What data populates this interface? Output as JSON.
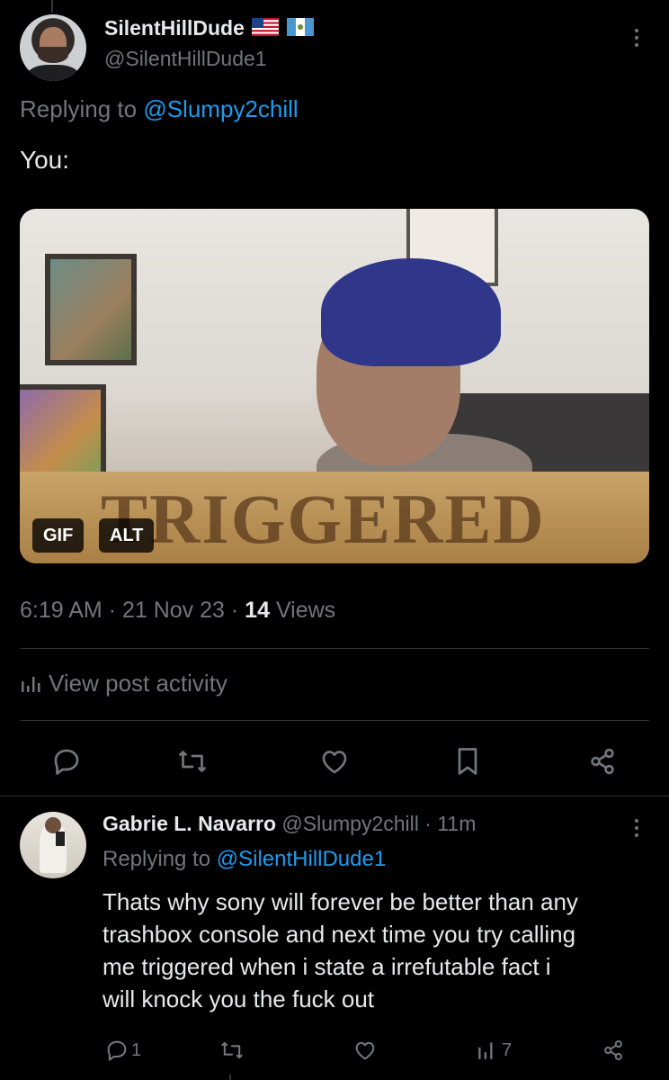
{
  "tweet": {
    "display_name": "SilentHillDude",
    "flags": [
      "us-flag",
      "guatemala-flag"
    ],
    "handle": "@SilentHillDude1",
    "replying_prefix": "Replying to",
    "replying_to": "@Slumpy2chill",
    "text": "You:",
    "media": {
      "overlay_text": "TRIGGERED",
      "badges": [
        "GIF",
        "ALT"
      ]
    },
    "time": "6:19 AM",
    "date": "21 Nov 23",
    "views_count": "14",
    "views_label": "Views",
    "separator": "·",
    "activity_label": "View post activity",
    "actions": [
      "reply-icon",
      "retweet-icon",
      "like-icon",
      "bookmark-icon",
      "share-icon"
    ]
  },
  "reply": {
    "display_name": "Gabrie L. Navarro",
    "handle": "@Slumpy2chill",
    "time_ago": "11m",
    "separator": "·",
    "replying_prefix": "Replying to",
    "replying_to": "@SilentHillDude1",
    "text_lines": [
      "Thats why sony will forever be better than any",
      "trashbox console and next time you try calling",
      "me triggered when i state a irrefutable fact i",
      "will knock you the fuck out"
    ],
    "reply_count": "1",
    "views_count": "7"
  },
  "colors": {
    "background": "#000000",
    "text": "#e7e9ea",
    "muted": "#71767b",
    "link": "#1d9bf0",
    "divider": "#2f3336"
  }
}
